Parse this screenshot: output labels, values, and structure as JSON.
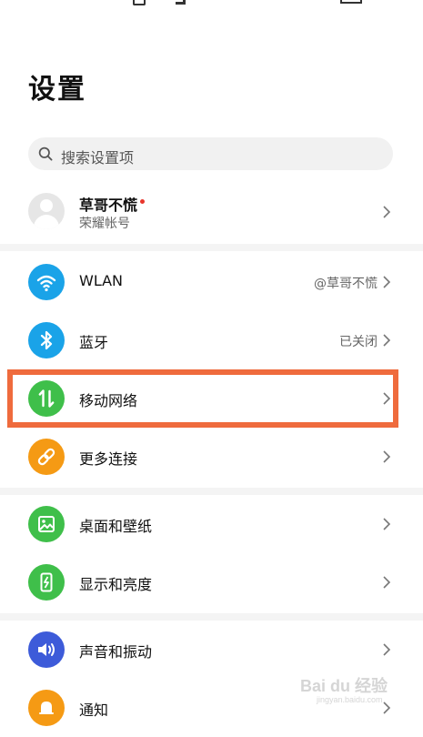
{
  "page": {
    "title": "设置"
  },
  "search": {
    "placeholder": "搜索设置项"
  },
  "account": {
    "name": "草哥不慌",
    "subtitle": "荣耀帐号"
  },
  "rows": [
    {
      "label": "WLAN",
      "value": "@草哥不慌",
      "icon": "wifi-icon",
      "color": "#1aa3e8"
    },
    {
      "label": "蓝牙",
      "value": "已关闭",
      "icon": "bluetooth-icon",
      "color": "#1aa3e8"
    },
    {
      "label": "移动网络",
      "value": "",
      "icon": "mobile-data-icon",
      "color": "#3fbf4a",
      "highlighted": true
    },
    {
      "label": "更多连接",
      "value": "",
      "icon": "link-icon",
      "color": "#f59a14"
    },
    {
      "label": "桌面和壁纸",
      "value": "",
      "icon": "wallpaper-icon",
      "color": "#3fbf4a"
    },
    {
      "label": "显示和亮度",
      "value": "",
      "icon": "display-icon",
      "color": "#3fbf4a"
    },
    {
      "label": "声音和振动",
      "value": "",
      "icon": "sound-icon",
      "color": "#3d5bd9"
    },
    {
      "label": "通知",
      "value": "",
      "icon": "bell-icon",
      "color": "#f59a14"
    }
  ],
  "colors": {
    "highlight": "#ef6b3d",
    "divider": "#f4f4f4",
    "badge": "#e8352b"
  },
  "watermark": {
    "text": "Bai du 经验",
    "sub": "jingyan.baidu.com"
  }
}
